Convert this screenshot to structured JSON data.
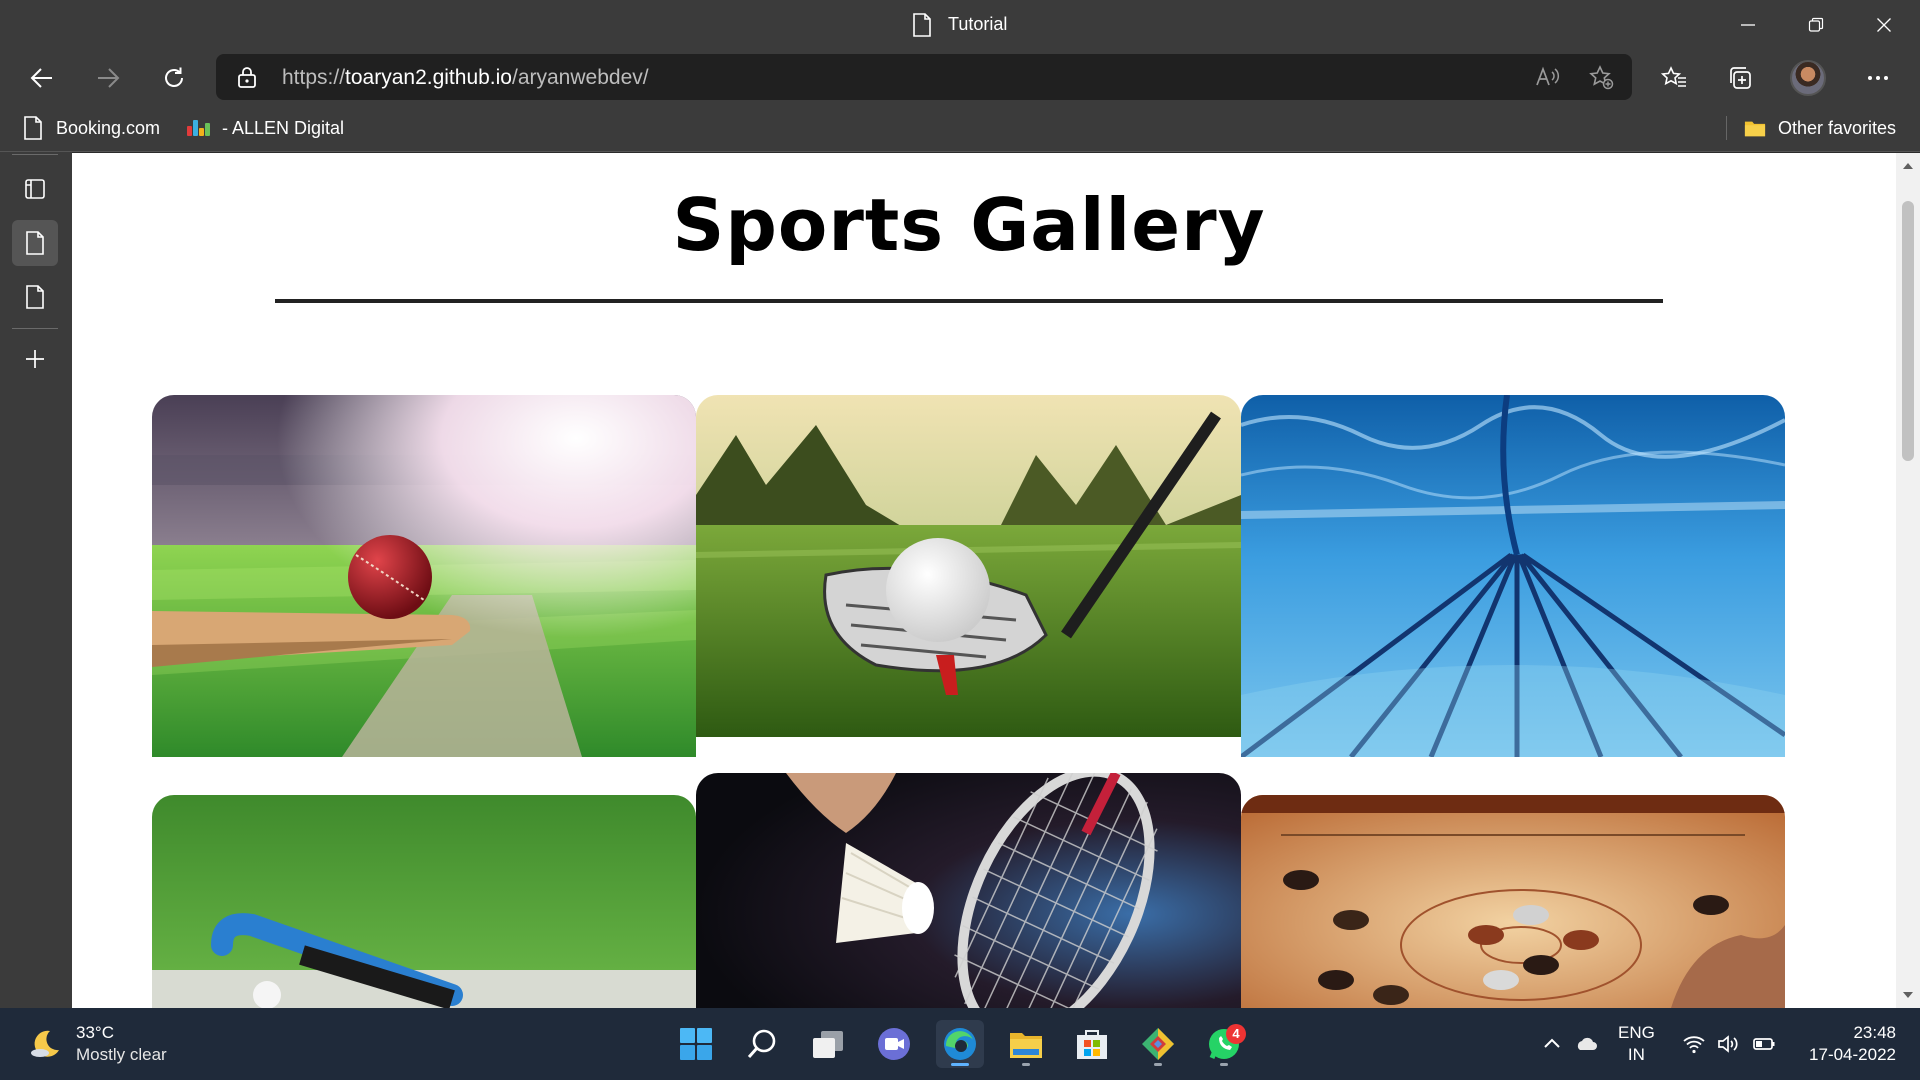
{
  "window": {
    "title": "Tutorial"
  },
  "address_bar": {
    "url_scheme": "https://",
    "url_host": "toaryan2.github.io",
    "url_path": "/aryanwebdev/"
  },
  "favorites": {
    "items": [
      {
        "label": "Booking.com",
        "icon": "page-icon"
      },
      {
        "label": "- ALLEN Digital",
        "icon": "allen-logo-icon"
      }
    ],
    "other_label": "Other favorites"
  },
  "page": {
    "title": "Sports Gallery",
    "gallery": [
      {
        "subject": "cricket",
        "icon": "cricket-ball-bat-image"
      },
      {
        "subject": "golf",
        "icon": "golf-ball-club-image"
      },
      {
        "subject": "swimming",
        "icon": "swimming-pool-image"
      },
      {
        "subject": "hockey",
        "icon": "hockey-stick-image"
      },
      {
        "subject": "badminton",
        "icon": "badminton-racket-image"
      },
      {
        "subject": "carrom",
        "icon": "carrom-board-image"
      }
    ]
  },
  "taskbar": {
    "weather": {
      "temp": "33°C",
      "condition": "Mostly clear"
    },
    "apps": [
      "start",
      "search",
      "task-view",
      "chat",
      "edge",
      "file-explorer",
      "store",
      "git",
      "whatsapp"
    ],
    "whatsapp_badge": "4",
    "language": {
      "line1": "ENG",
      "line2": "IN"
    },
    "time": "23:48",
    "date": "17-04-2022"
  },
  "colors": {
    "chrome_bg": "#3b3b3b",
    "address_bg": "#202020",
    "taskbar_bg": "#1f2a3a",
    "page_bg": "#ffffff"
  }
}
